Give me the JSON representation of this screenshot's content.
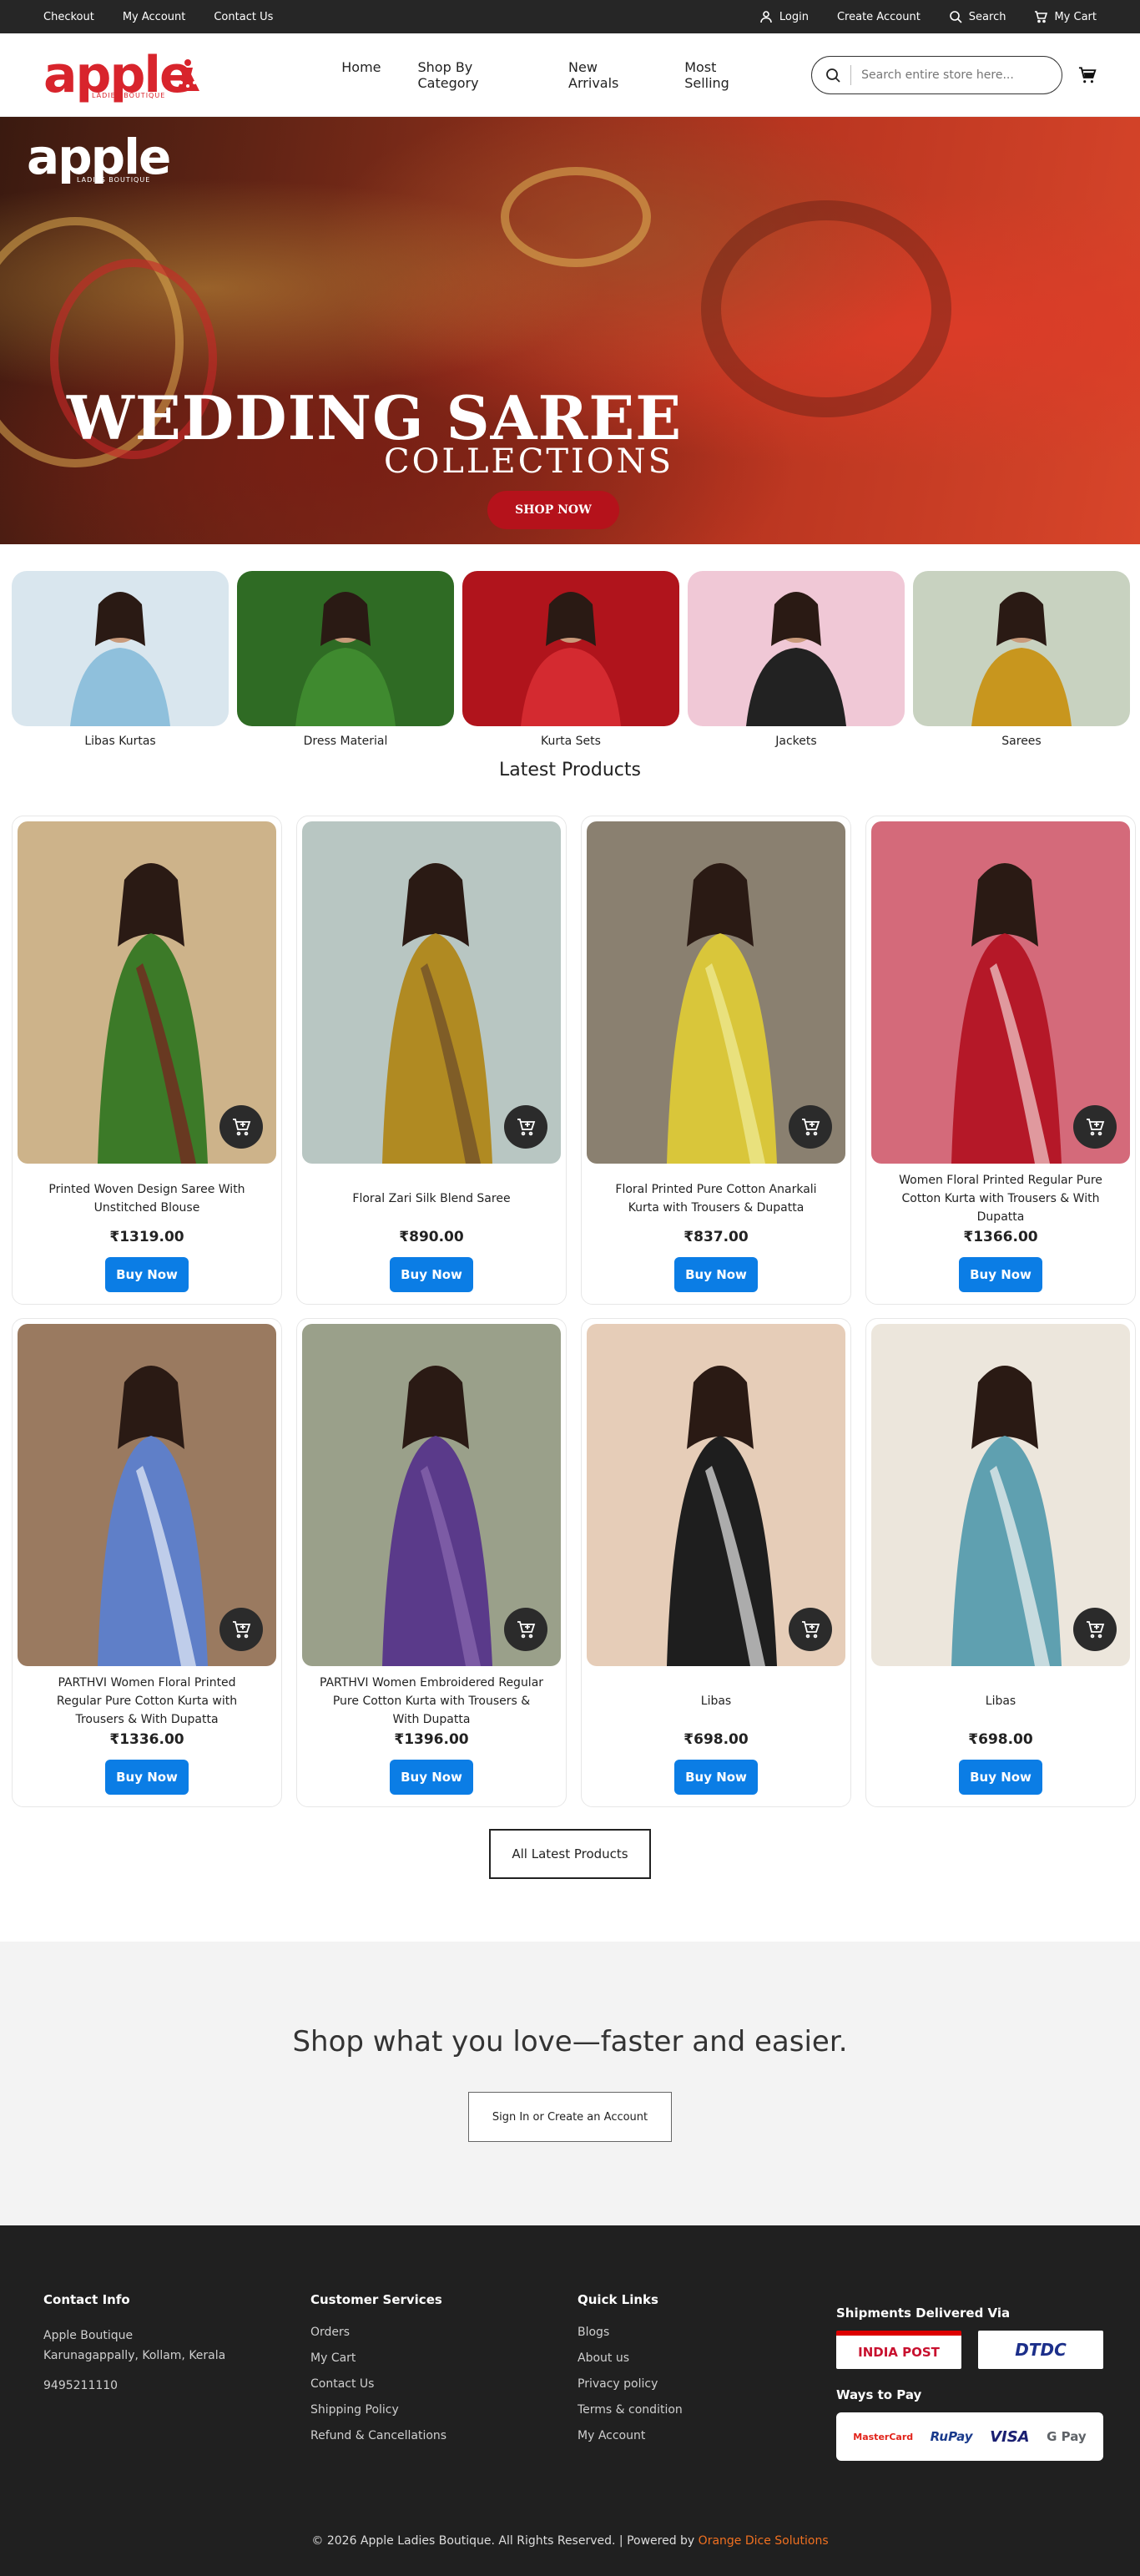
{
  "topbar": {
    "left_links": [
      "Checkout",
      "My Account",
      "Contact Us"
    ],
    "login": "Login",
    "create_account": "Create Account",
    "search": "Search",
    "my_cart": "My Cart"
  },
  "header": {
    "logo_text": "apple",
    "logo_sub": "LADIES BOUTIQUE",
    "nav": [
      "Home",
      "Shop By Category",
      "New Arrivals",
      "Most Selling"
    ],
    "search_placeholder": "Search entire store here..."
  },
  "hero": {
    "logo_text": "apple",
    "logo_sub": "LADIES BOUTIQUE",
    "title": "WEDDING SAREE",
    "subtitle": "COLLECTIONS",
    "button": "SHOP NOW"
  },
  "categories": [
    {
      "label": "Libas Kurtas",
      "bg": "#d9e6ee",
      "dress": "#8fc0dc"
    },
    {
      "label": "Dress Material",
      "bg": "#2f6b24",
      "dress": "#3f8a2f"
    },
    {
      "label": "Kurta Sets",
      "bg": "#b0141c",
      "dress": "#d42a30"
    },
    {
      "label": "Jackets",
      "bg": "#f0c8d6",
      "dress": "#222222"
    },
    {
      "label": "Sarees",
      "bg": "#c8d2c0",
      "dress": "#c8961e"
    }
  ],
  "latest_title": "Latest Products",
  "products": [
    {
      "name": "Printed Woven Design Saree With Unstitched Blouse",
      "price": "₹1319.00",
      "bg": "#cdb38a",
      "dress": "#3c7a28",
      "accent": "#7a1e1e"
    },
    {
      "name": "Floral Zari Silk Blend Saree",
      "price": "₹890.00",
      "bg": "#b8c6c2",
      "dress": "#b08a22",
      "accent": "#6b4a2a"
    },
    {
      "name": "Floral Printed Pure Cotton Anarkali Kurta with Trousers & Dupatta",
      "price": "₹837.00",
      "bg": "#8a8070",
      "dress": "#d9c63a",
      "accent": "#f0ec9a"
    },
    {
      "name": "Women Floral Printed Regular Pure Cotton Kurta with Trousers & With Dupatta",
      "price": "₹1366.00",
      "bg": "#d46a7a",
      "dress": "#b51828",
      "accent": "#f2d0d0"
    },
    {
      "name": "PARTHVI Women Floral Printed Regular Pure Cotton Kurta with Trousers & With Dupatta",
      "price": "₹1336.00",
      "bg": "#9a7a60",
      "dress": "#5f7fc8",
      "accent": "#e8eef8"
    },
    {
      "name": "PARTHVI Women Embroidered Regular Pure Cotton Kurta with Trousers & With Dupatta",
      "price": "₹1396.00",
      "bg": "#9aa08a",
      "dress": "#5a3a8a",
      "accent": "#8a6ab0"
    },
    {
      "name": "Libas",
      "price": "₹698.00",
      "bg": "#e6cdb8",
      "dress": "#1e1e1e",
      "accent": "#e8e8e8"
    },
    {
      "name": "Libas",
      "price": "₹698.00",
      "bg": "#ece6dc",
      "dress": "#5fa0b0",
      "accent": "#f4f4f4"
    }
  ],
  "buy_label": "Buy Now",
  "all_latest": "All Latest Products",
  "cta": {
    "title": "Shop what you love—faster and easier.",
    "button": "Sign In or Create an Account"
  },
  "footer": {
    "contact": {
      "title": "Contact Info",
      "name": "Apple Boutique",
      "address": "Karunagappally, Kollam, Kerala",
      "phone": "9495211110"
    },
    "services": {
      "title": "Customer Services",
      "links": [
        "Orders",
        "My Cart",
        "Contact Us",
        "Shipping Policy",
        "Refund & Cancellations"
      ]
    },
    "quick": {
      "title": "Quick Links",
      "links": [
        "Blogs",
        "About us",
        "Privacy policy",
        "Terms & condition",
        "My Account"
      ]
    },
    "shipments_title": "Shipments Delivered Via",
    "shipping": [
      "INDIA POST",
      "DTDC"
    ],
    "pay_title": "Ways to Pay",
    "payments": [
      "MasterCard",
      "RuPay",
      "VISA",
      "G Pay"
    ],
    "copyright": "© 2026 Apple Ladies Boutique. All Rights Reserved. | Powered by",
    "powered_by": "Orange Dice Solutions"
  }
}
